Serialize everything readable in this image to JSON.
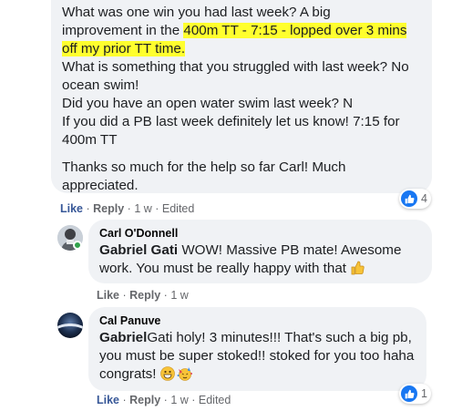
{
  "post": {
    "lines": [
      "What was one win you had last week? A big",
      "improvement in the ",
      "400m TT - 7:15 - lopped over 3 mins",
      "off my prior TT time.",
      "What is something that you struggled with last week? No ocean swim!",
      "Did you have an open water swim last week? N",
      "If you did a PB last week definitely let us know! 7:15 for 400m TT",
      "Thanks so much for the help so far Carl! Much appreciated."
    ],
    "actions": {
      "like": "Like",
      "reply": "Reply",
      "time": "1 w",
      "edited": "Edited"
    },
    "reaction_count": "4"
  },
  "comments": [
    {
      "author": "Carl O'Donnell",
      "mention": "Gabriel Gati",
      "text": " WOW! Massive PB mate! Awesome work. You must be really happy with that ",
      "actions": {
        "like": "Like",
        "reply": "Reply",
        "time": "1 w"
      }
    },
    {
      "author": "Cal Panuve",
      "mention": "Gabriel",
      "text": "Gati holy! 3 minutes!!! That's such a big pb, you must be super stoked!! stoked for you too haha congrats! ",
      "actions": {
        "like": "Like",
        "reply": "Reply",
        "time": "1 w",
        "edited": "Edited"
      },
      "reaction_count": "1"
    }
  ],
  "colors": {
    "bubble": "#f0f2f5",
    "highlight": "#ffff2e",
    "link_blue": "#385898",
    "like_blue": "#1877f2",
    "meta_gray": "#65676b"
  },
  "icons": [
    "thumbs-up-emoji",
    "grinning-emoji",
    "partying-face-emoji",
    "like-reaction-icon"
  ]
}
